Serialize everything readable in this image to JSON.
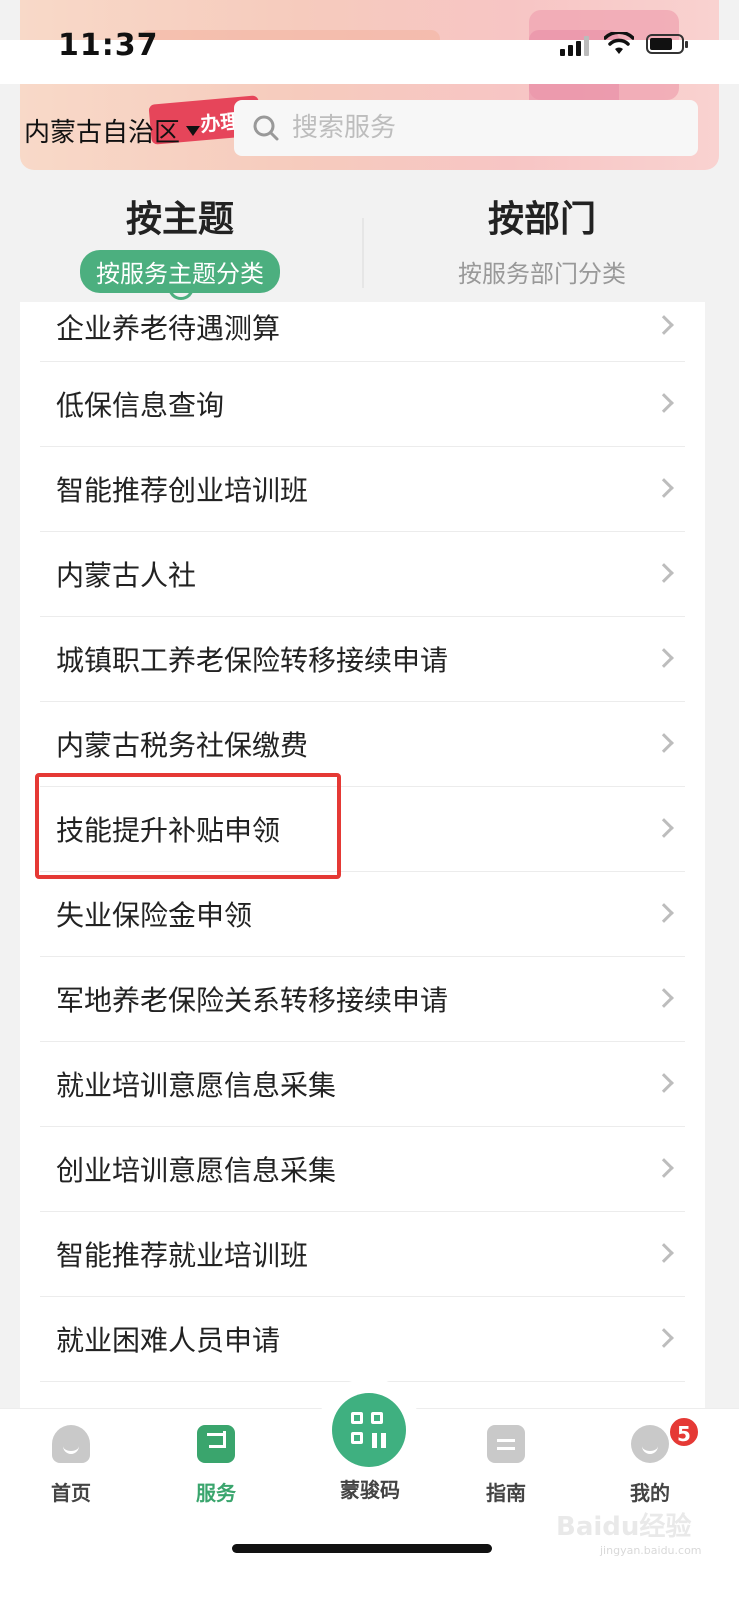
{
  "status_bar": {
    "time": "11:37"
  },
  "banner": {
    "tag_text": "办理"
  },
  "header": {
    "region": "内蒙古自治区",
    "search_placeholder": "搜索服务"
  },
  "tabs": [
    {
      "title": "按主题",
      "subtitle": "按服务主题分类",
      "active": true
    },
    {
      "title": "按部门",
      "subtitle": "按服务部门分类",
      "active": false
    }
  ],
  "services": [
    "企业养老待遇测算",
    "低保信息查询",
    "智能推荐创业培训班",
    "内蒙古人社",
    "城镇职工养老保险转移接续申请",
    "内蒙古税务社保缴费",
    "技能提升补贴申领",
    "失业保险金申领",
    "军地养老保险关系转移接续申请",
    "就业培训意愿信息采集",
    "创业培训意愿信息采集",
    "智能推荐就业培训班",
    "就业困难人员申请"
  ],
  "highlighted_item": "技能提升补贴申领",
  "bottom_nav": {
    "items": [
      {
        "label": "首页",
        "icon": "home-icon"
      },
      {
        "label": "服务",
        "icon": "bookmark-icon",
        "active": true
      },
      {
        "label": "蒙骏码",
        "icon": "qr-code-icon"
      },
      {
        "label": "指南",
        "icon": "guide-icon"
      },
      {
        "label": "我的",
        "icon": "profile-icon",
        "badge": "5"
      }
    ]
  },
  "watermark": {
    "main": "Baidu经验",
    "sub": "jingyan.baidu.com"
  },
  "colors": {
    "accent": "#4caf7f",
    "highlight": "#e53935",
    "badge": "#e53935"
  }
}
